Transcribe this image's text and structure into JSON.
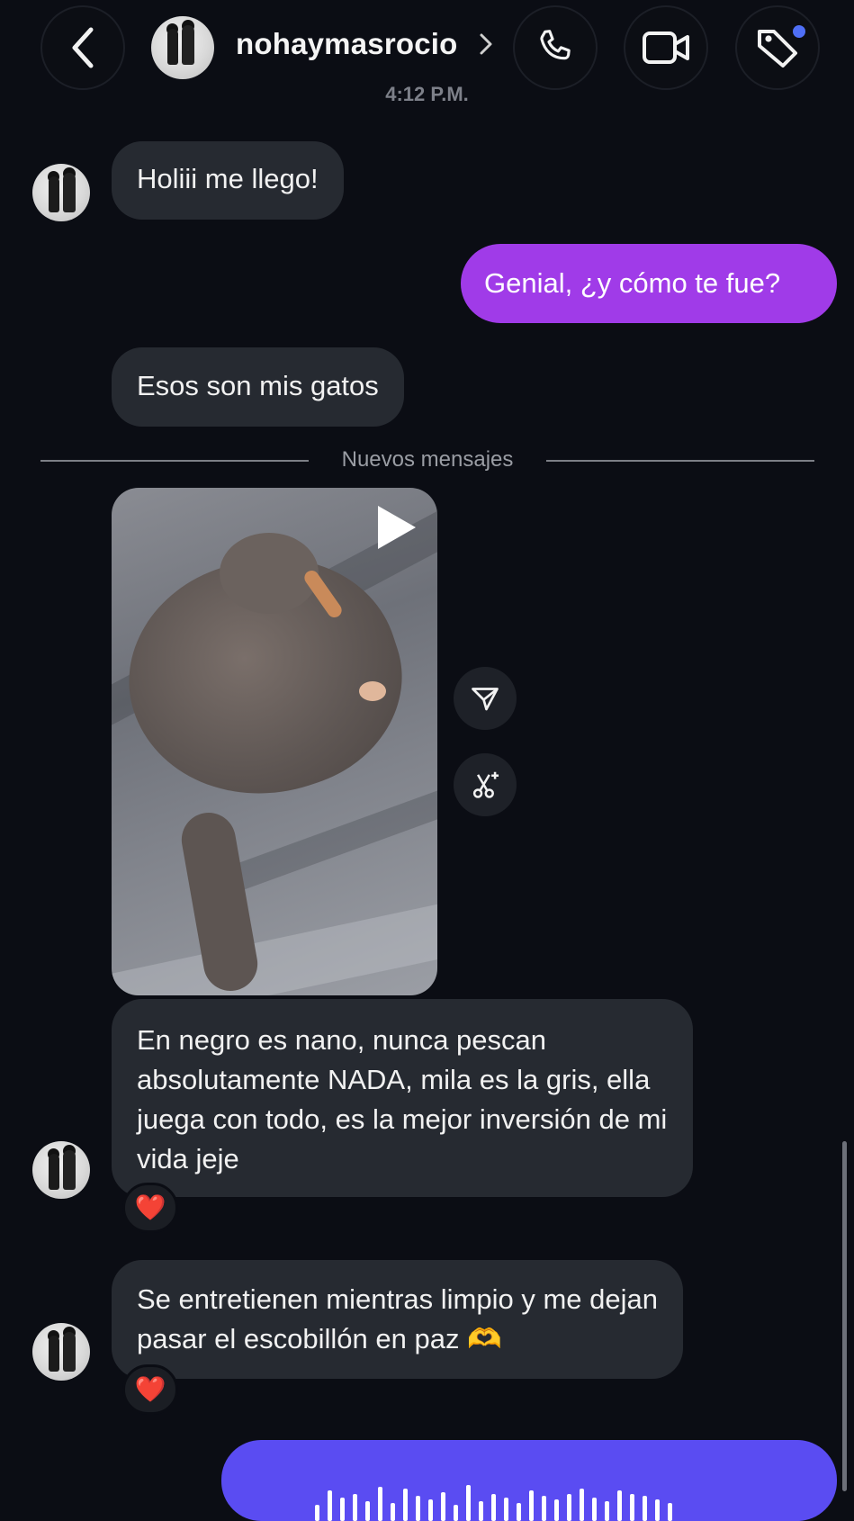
{
  "header": {
    "username": "nohaymasrocio",
    "time": "4:12 P.M.",
    "icons": [
      "back-arrow-icon",
      "phone-icon",
      "video-camera-icon",
      "tag-icon"
    ],
    "notification_dot_color": "#4f6ff6"
  },
  "messages": [
    {
      "from": "them",
      "text": "Holiii me llego!"
    },
    {
      "from": "me",
      "text": "Genial, ¿y cómo te fue?"
    },
    {
      "from": "them",
      "text": "Esos son mis gatos"
    }
  ],
  "divider": {
    "label": "Nuevos mensajes"
  },
  "media_message": {
    "kind": "video",
    "icons": [
      "play-icon",
      "share-icon",
      "remix-scissors-icon"
    ]
  },
  "messages_after": [
    {
      "from": "them",
      "text": "En negro es nano, nunca pescan absolutamente NADA, mila es la gris, ella juega con todo, es la mejor inversión de mi vida jeje",
      "reaction": "❤️"
    },
    {
      "from": "them",
      "text": "Se entretienen mientras limpio y me dejan pasar el escobillón en paz 🫶",
      "reaction": "❤️"
    }
  ],
  "voice_message": {
    "from": "me",
    "color": "#5a4cf2"
  },
  "colors": {
    "background": "#0b0d14",
    "incoming_bubble": "#262a31",
    "outgoing_bubble": "#a03be8"
  }
}
